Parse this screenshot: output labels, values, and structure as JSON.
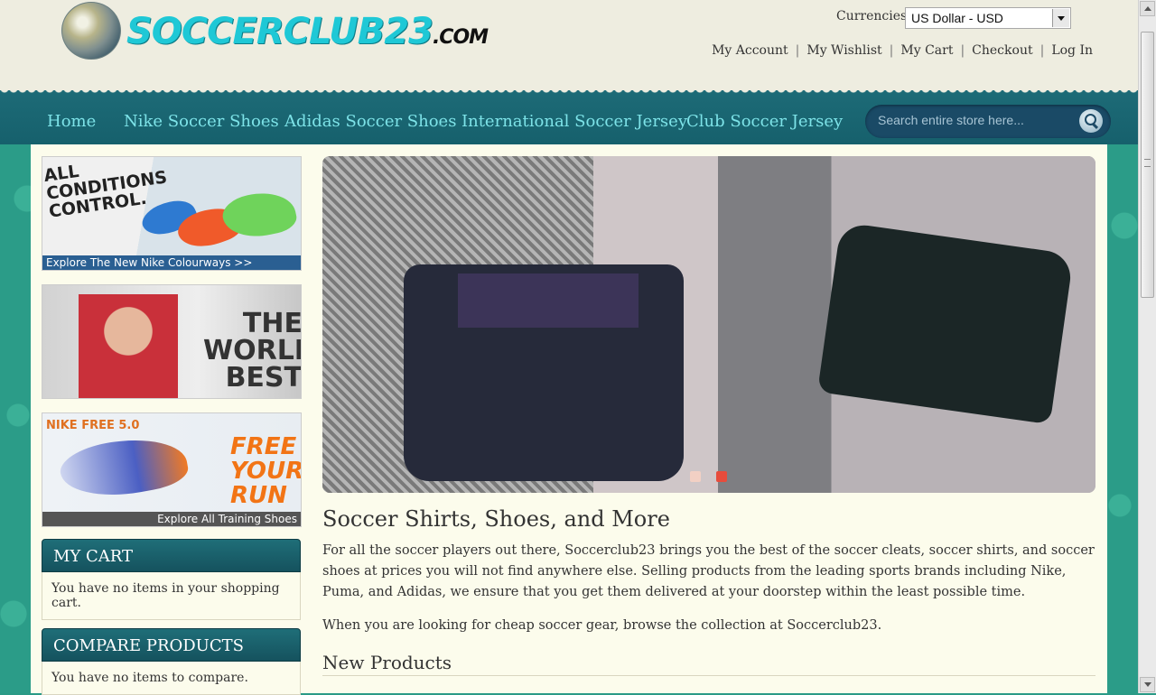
{
  "header": {
    "logo_text": "SOCCERCLUB23",
    "logo_suffix": ".COM",
    "currency_label": "Currencies",
    "currency_value": "US Dollar - USD",
    "links": [
      "My Account",
      "My Wishlist",
      "My Cart",
      "Checkout",
      "Log In"
    ]
  },
  "nav": {
    "items": [
      "Home",
      "Nike Soccer Shoes",
      "Adidas Soccer Shoes",
      "International Soccer Jersey",
      "Club Soccer Jersey"
    ],
    "search_placeholder": "Search entire store here..."
  },
  "banners": {
    "b1_text": "ALL CONDITIONS CONTROL.",
    "b1_strip": "Explore The New Nike Colourways >>",
    "b2_text": "THE WORLD'S BEST",
    "b3_text1": "NIKE FREE 5.0",
    "b3_text2": "FREE YOUR RUN",
    "b3_strip": "Explore All Training Shoes"
  },
  "cart": {
    "title": "MY CART",
    "body": "You have no items in your shopping cart."
  },
  "compare": {
    "title": "COMPARE PRODUCTS",
    "body": "You have no items to compare."
  },
  "slider": {
    "active_index": 1,
    "dot_colors": [
      "#f2d0c4",
      "#e74c3c"
    ]
  },
  "content": {
    "title": "Soccer Shirts, Shoes, and More",
    "para1": "For all the soccer players out there, Soccerclub23 brings you the best of the soccer cleats, soccer shirts, and soccer shoes at prices you will not find anywhere else. Selling products from the leading sports brands including Nike, Puma, and Adidas, we ensure that you get them delivered at your doorstep within the least possible time.",
    "para2": "When you are looking for cheap soccer gear, browse the collection at Soccerclub23.",
    "new_products": "New Products"
  }
}
